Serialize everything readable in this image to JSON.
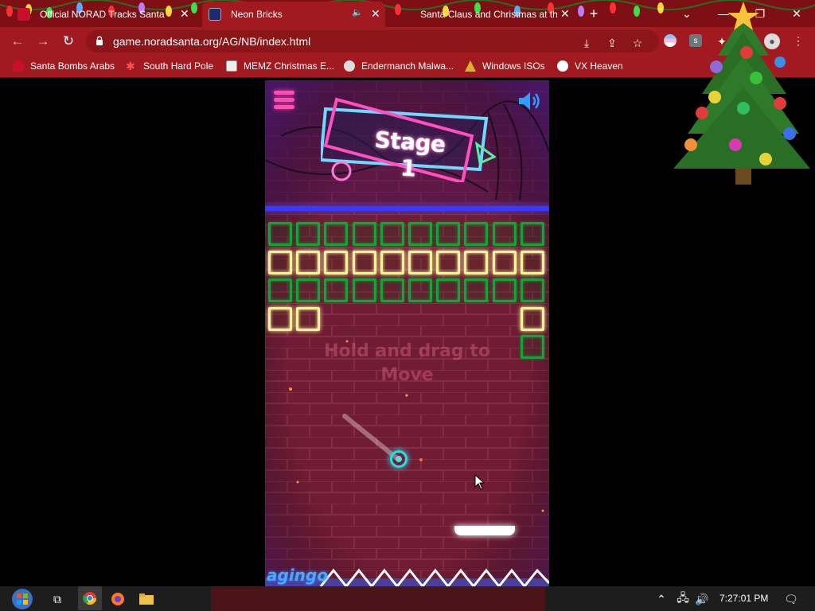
{
  "tabs": [
    {
      "title": "Official NORAD Tracks Santa",
      "active": false
    },
    {
      "title": "Neon Bricks",
      "active": true
    },
    {
      "title": "Santa Claus and Christmas at the",
      "active": false
    }
  ],
  "window": {
    "new_tab": "+",
    "minimize": "—",
    "maximize": "❐",
    "close": "✕",
    "tab_search": "⌄"
  },
  "address_bar": {
    "url": "game.noradsanta.org/AG/NB/index.html"
  },
  "bookmarks": [
    {
      "label": "Santa Bombs Arabs",
      "icon": "santa-icon"
    },
    {
      "label": "South Hard Pole",
      "icon": "snowflake-icon"
    },
    {
      "label": "MEMZ Christmas E...",
      "icon": "memz-icon"
    },
    {
      "label": "Endermanch Malwa...",
      "icon": "endermanch-icon"
    },
    {
      "label": "Windows ISOs",
      "icon": "tree-icon"
    },
    {
      "label": "VX Heaven",
      "icon": "vx-icon"
    }
  ],
  "game": {
    "stage_label": "Stage 1",
    "hint_line1": "Hold and drag to",
    "hint_line2": "Move",
    "logo": "agingo",
    "brick_rows": [
      [
        "green",
        "green",
        "green",
        "green",
        "green",
        "green",
        "green",
        "green",
        "green",
        "green"
      ],
      [
        "yellow",
        "yellow",
        "yellow",
        "yellow",
        "yellow",
        "yellow",
        "yellow",
        "yellow",
        "yellow",
        "yellow"
      ],
      [
        "green",
        "green",
        "green",
        "green",
        "green",
        "green",
        "green",
        "green",
        "green",
        "green"
      ],
      [
        "yellow",
        "yellow",
        "",
        "",
        "",
        "",
        "",
        "",
        "",
        "yellow"
      ],
      [
        "",
        "",
        "",
        "",
        "",
        "",
        "",
        "",
        "",
        "green"
      ]
    ],
    "colors": {
      "green_brick": "#1aa03a",
      "yellow_brick": "#f6f29a",
      "ball": "#1ee3e6",
      "menu": "#ff4fb3",
      "sound": "#2aa0ff"
    }
  },
  "taskbar": {
    "time": "7:27:01 PM"
  }
}
